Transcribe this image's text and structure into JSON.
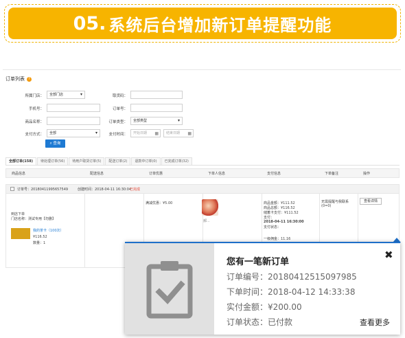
{
  "banner": {
    "number": "05.",
    "title": "系统后台增加新订单提醒功能"
  },
  "admin": {
    "list_title": "订单列表",
    "help_glyph": "?",
    "filters": {
      "store_label": "所属门店：",
      "store_value": "全部门店",
      "pickup_code_label": "取货码：",
      "phone_label": "手机号：",
      "order_no_label": "订单号：",
      "product_name_label": "商品名称：",
      "order_type_label": "订单类型：",
      "order_type_value": "全部类型",
      "payment_method_label": "支付方式：",
      "payment_method_value": "全部",
      "payment_time_label": "支付时间：",
      "start_date_placeholder": "开始日期",
      "end_date_placeholder": "结束日期",
      "search_button": "查询"
    },
    "tabs": [
      "全部订单(158)",
      "待处理订单(56)",
      "待用户取货订单(5)",
      "配送订单(2)",
      "退款中订单(0)",
      "已完成订单(32)"
    ],
    "table_headers": [
      "商品信息",
      "配送信息",
      "订单优惠",
      "下单人信息",
      "支付信息",
      "下单备注",
      "操作"
    ],
    "order": {
      "header_no": "订单号：20180411995657549",
      "header_created": "创建时间：2018-04-11 16:30:04",
      "header_status": "已完成",
      "pickup_type": "到店下单",
      "store_name": "门店名称：测试专用【勿删】",
      "product_name": "我的茶卡（100次）",
      "price": "¥116.52",
      "quantity": "数量：1",
      "discount": "满减优惠：¥5.00",
      "customer": "郝...",
      "pay_total": "商品金额：¥111.52",
      "goods_amount": "商品总额：¥116.52",
      "card_pay": "储蓄卡支付：¥111.52",
      "pay_amount": "支付：",
      "pay_time": "2018-04-11 16:30:00",
      "pay_status": "支付状态：",
      "commission": "一级佣金：11.16",
      "remark": "无需提醒与我联系(0=0)",
      "view_detail": "查看详情"
    }
  },
  "popup": {
    "title": "您有一笔新订单",
    "close_glyph": "✖",
    "order_no": "订单编号：20180412515097985",
    "order_time": "下单时间：2018-04-12 14:33:38",
    "paid_amount": "实付金额：¥200.00",
    "status": "订单状态：已付款",
    "more_link": "查看更多"
  },
  "colors": {
    "banner": "#f7b400",
    "accent_blue": "#1e6fc9",
    "status_red": "#e74c3c"
  }
}
